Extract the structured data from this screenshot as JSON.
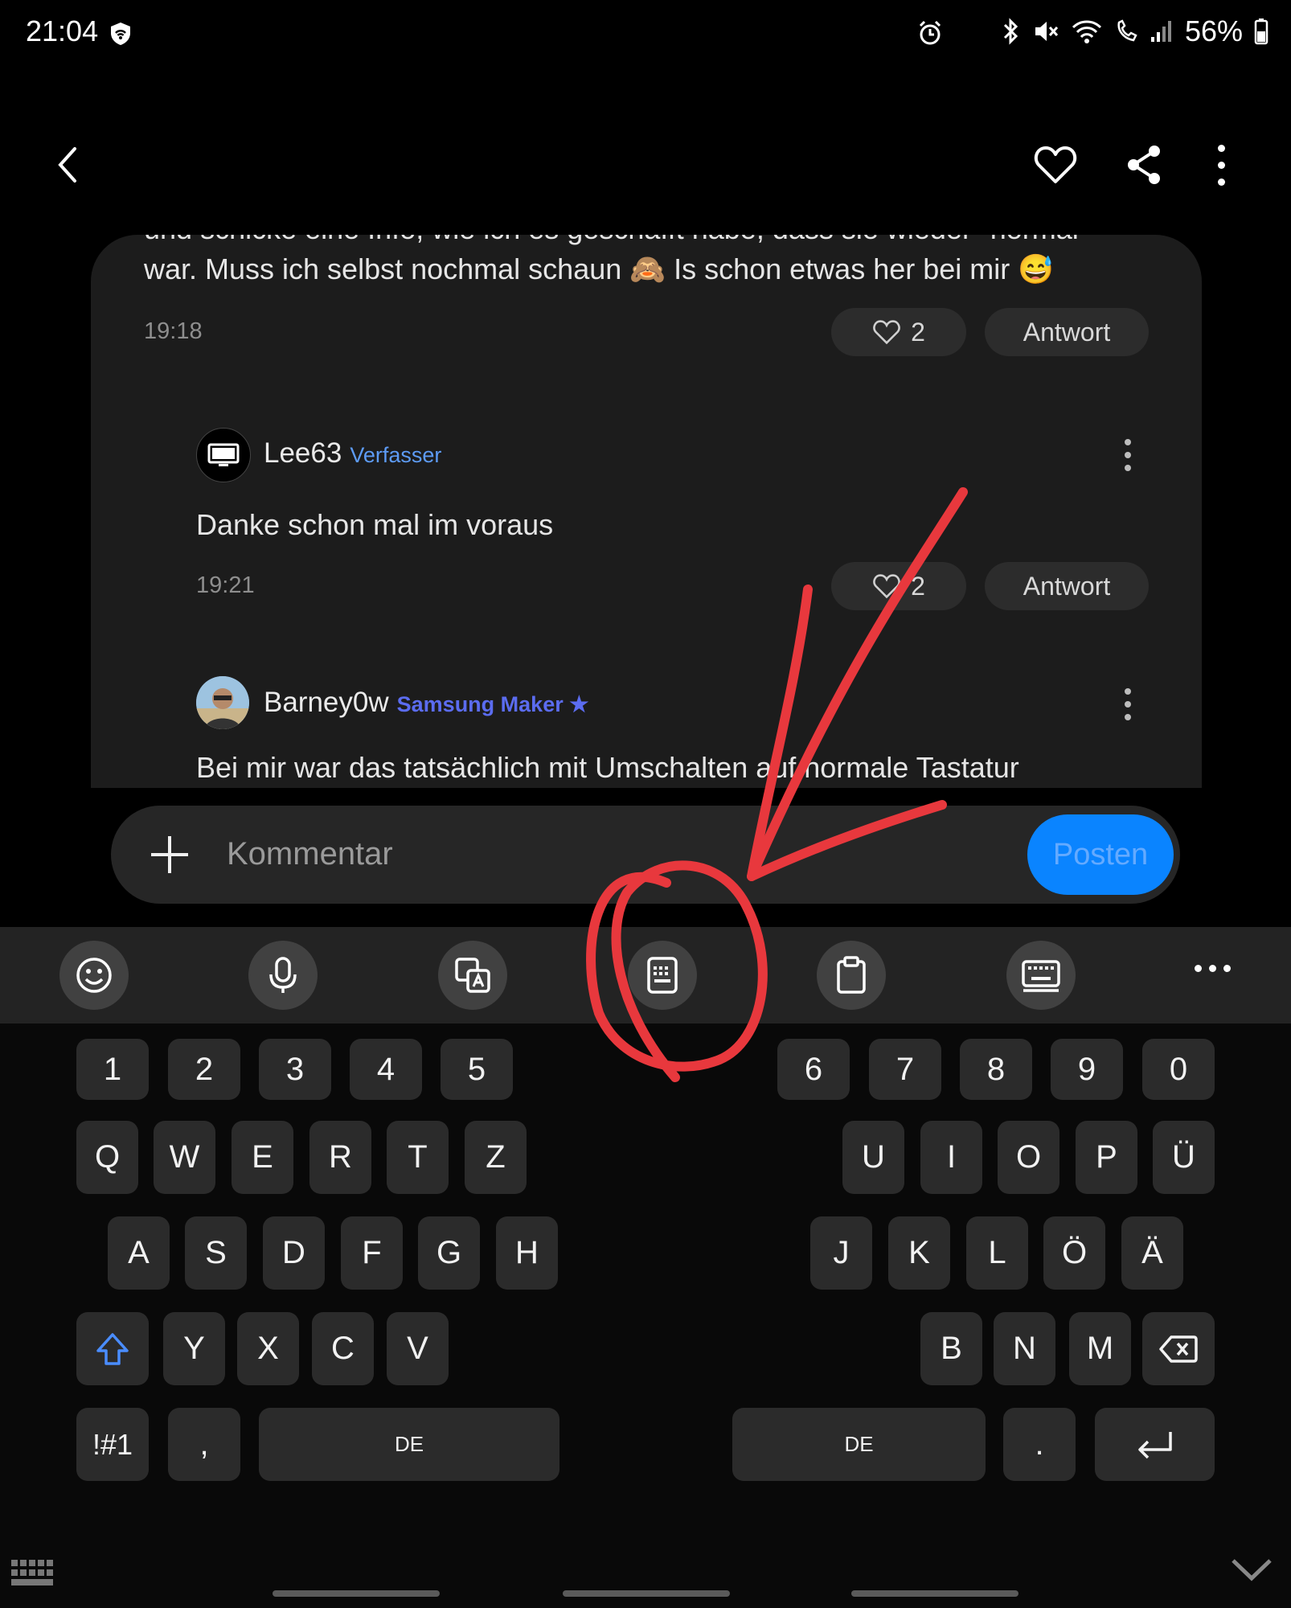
{
  "status_bar": {
    "time": "21:04",
    "battery": "56%"
  },
  "top_bar": {
    "icons": [
      "back-icon",
      "heart-icon",
      "share-icon",
      "more-vertical-icon"
    ]
  },
  "comments": {
    "first": {
      "text_line1": "und schicke eine Info, wie ich es geschafft habe, dass sie wieder \"normal\"",
      "text_line2": "war. Muss ich selbst nochmal schaun 🙈 Is schon etwas her bei mir 😅",
      "time": "19:18",
      "likes": "2",
      "reply": "Antwort"
    },
    "second": {
      "user": "Lee63",
      "badge": "Verfasser",
      "text": "Danke schon mal im voraus",
      "time": "19:21",
      "likes": "2",
      "reply": "Antwort"
    },
    "third": {
      "user": "Barney0w",
      "badge": "Samsung Maker ★",
      "text": "Bei mir war das tatsächlich mit Umschalten auf normale Tastatur"
    }
  },
  "comment_input": {
    "placeholder": "Kommentar",
    "post_label": "Posten"
  },
  "keyboard": {
    "toolbar_icons": [
      "emoji-icon",
      "microphone-icon",
      "translate-icon",
      "keyboard-mode-icon",
      "clipboard-icon",
      "keyboard-layout-icon",
      "more-horizontal-icon"
    ],
    "row_numbers_left": [
      "1",
      "2",
      "3",
      "4",
      "5"
    ],
    "row_numbers_right": [
      "6",
      "7",
      "8",
      "9",
      "0"
    ],
    "row_q_left": [
      "Q",
      "W",
      "E",
      "R",
      "T",
      "Z"
    ],
    "row_q_right": [
      "U",
      "I",
      "O",
      "P",
      "Ü"
    ],
    "row_a_left": [
      "A",
      "S",
      "D",
      "F",
      "G",
      "H"
    ],
    "row_a_right": [
      "J",
      "K",
      "L",
      "Ö",
      "Ä"
    ],
    "row_y_left": [
      "Y",
      "X",
      "C",
      "V"
    ],
    "row_y_right": [
      "B",
      "N",
      "M"
    ],
    "symbols_key": "!#1",
    "comma_key": ",",
    "space_left": "DE",
    "space_right": "DE",
    "period_key": "."
  },
  "annotation": {
    "color": "#e8383d"
  }
}
